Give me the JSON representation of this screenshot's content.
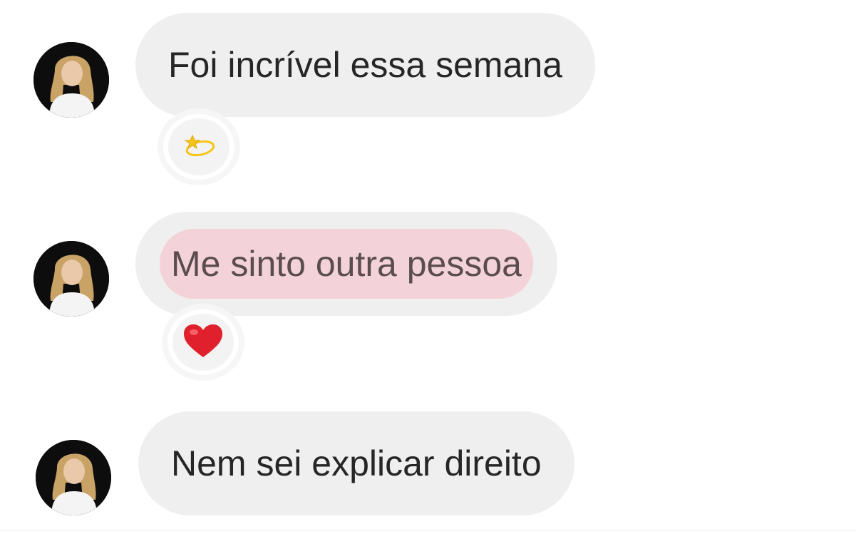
{
  "messages": [
    {
      "text": "Foi incrível essa semana",
      "reaction": "dizzy-star-emoji",
      "highlighted": false
    },
    {
      "text": "Me sinto outra pessoa",
      "reaction": "red-heart-emoji",
      "highlighted": true
    },
    {
      "text": "Nem sei explicar direito",
      "reaction": null,
      "highlighted": false
    }
  ],
  "colors": {
    "bubble": "#efefef",
    "highlight": "#f3d3d9",
    "text": "#262626",
    "avatar_bg": "#0d0d0d",
    "heart": "#e0202c",
    "star": "#f5c518"
  }
}
